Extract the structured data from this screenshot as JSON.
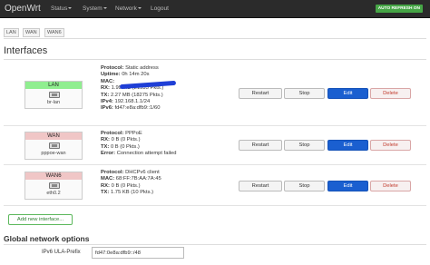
{
  "navbar": {
    "brand": "OpenWrt",
    "items": [
      "Status",
      "System",
      "Network",
      "Logout"
    ],
    "auto_refresh": "AUTO REFRESH ON"
  },
  "tabs": [
    "LAN",
    "WAN",
    "WAN6"
  ],
  "section_title": "Interfaces",
  "interfaces": [
    {
      "name": "LAN",
      "device": "br-lan",
      "color": "#90ee90",
      "lines": [
        {
          "label": "Protocol:",
          "value": "Static address"
        },
        {
          "label": "Uptime:",
          "value": "0h 14m 20s"
        },
        {
          "label": "MAC:",
          "value": ""
        },
        {
          "label": "RX:",
          "value": "1.99 MB (21535 Pkts.)"
        },
        {
          "label": "TX:",
          "value": "2.27 MB (18275 Pkts.)"
        },
        {
          "label": "IPv4:",
          "value": "192.168.1.1/24"
        },
        {
          "label": "IPv6:",
          "value": "fd47:e8a:dfb9::1/60"
        }
      ]
    },
    {
      "name": "WAN",
      "device": "pppoe-wan",
      "color": "#f0c6c6",
      "lines": [
        {
          "label": "Protocol:",
          "value": "PPPoE"
        },
        {
          "label": "RX:",
          "value": "0 B (0 Pkts.)"
        },
        {
          "label": "TX:",
          "value": "0 B (0 Pkts.)"
        },
        {
          "label": "Error:",
          "value": "Connection attempt failed"
        }
      ]
    },
    {
      "name": "WAN6",
      "device": "eth0.2",
      "color": "#f0c6c6",
      "lines": [
        {
          "label": "Protocol:",
          "value": "DHCPv6 client"
        },
        {
          "label": "MAC:",
          "value": "68:FF:7B:AA:7A:45"
        },
        {
          "label": "RX:",
          "value": "0 B (0 Pkts.)"
        },
        {
          "label": "TX:",
          "value": "1.75 KB (10 Pkts.)"
        }
      ]
    }
  ],
  "buttons": {
    "restart": "Restart",
    "stop": "Stop",
    "edit": "Edit",
    "delete": "Delete"
  },
  "add_interface": "Add new interface...",
  "global": {
    "title": "Global network options",
    "ula_label": "IPv6 ULA-Prefix",
    "ula_value": "fd47:0e8a:dfb9::/48"
  },
  "colors": {
    "accent": "#1a5fd0",
    "auto_refresh": "#46a546",
    "delete_text": "#c0392b"
  }
}
